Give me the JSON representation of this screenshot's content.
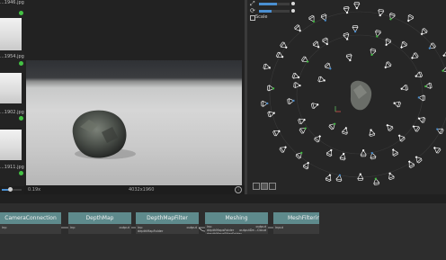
{
  "gallery": {
    "items": [
      {
        "label": "...1946.jpg",
        "status": "ok"
      },
      {
        "label": "...1954.jpg",
        "status": "ok"
      },
      {
        "label": "...1902.jpg",
        "status": "ok"
      },
      {
        "label": "...1911.jpg",
        "status": "ok"
      }
    ],
    "slider_fraction": 0.4
  },
  "viewer": {
    "zoom": "0.19x",
    "resolution": "4032x1960",
    "info_icon": "info-icon"
  },
  "viewer3d": {
    "controls": {
      "scale_label": "Scale",
      "icons": [
        "transform-icon",
        "rotate-icon"
      ]
    },
    "toolbar": [
      "square-icon",
      "grid-icon",
      "camera-icon"
    ]
  },
  "graph": {
    "nodes": [
      {
        "title": "CameraConnection",
        "in_port": "inp",
        "out_port": ""
      },
      {
        "title": "DepthMap",
        "in_port": "inp",
        "out_port": "output"
      },
      {
        "title": "DepthMapFilter",
        "in_port": "inp",
        "in_port2": "depthMapFolder",
        "out_port": "output"
      },
      {
        "title": "Meshing",
        "in_port": "inp",
        "in_port2": "depthMapsFolder",
        "in_port3": "depthMapsFilterFolder",
        "out_port": "output",
        "out_port2": "outputDe...Cloud"
      },
      {
        "title": "MeshFiltering",
        "in_port": "input",
        "out_port": ""
      }
    ]
  },
  "colors": {
    "node_header": "#5e8a8c",
    "accent": "#4a8fd1",
    "status_ok": "#44c244",
    "camera_marker": "#e8e8e8"
  }
}
